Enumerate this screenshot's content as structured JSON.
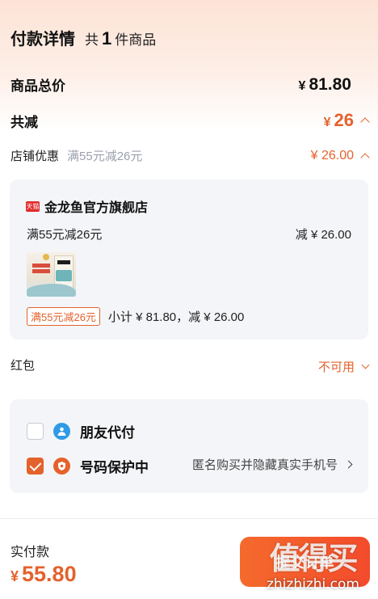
{
  "header": {
    "title": "付款详情",
    "count_prefix": "共",
    "count": "1",
    "count_suffix": "件商品"
  },
  "totals": {
    "goods_total_label": "商品总价",
    "currency": "¥",
    "goods_total_value": "81.80",
    "discount_label": "共减",
    "discount_value": "26"
  },
  "shop_discount": {
    "label": "店铺优惠",
    "description": "满55元减26元",
    "value": "¥ 26.00"
  },
  "shop_card": {
    "badge": "天猫",
    "shop_name": "金龙鱼官方旗舰店",
    "promo_text": "满55元减26元",
    "promo_reduce": "减 ¥ 26.00",
    "promo_tag": "满55元减26元",
    "subtotal_text": "小计 ¥ 81.80，减 ¥ 26.00"
  },
  "red_packet": {
    "label": "红包",
    "status": "不可用"
  },
  "options": {
    "friend_pay_label": "朋友代付",
    "friend_pay_checked": false,
    "privacy_label": "号码保护中",
    "privacy_checked": true,
    "privacy_hint": "匿名购买并隐藏真实手机号"
  },
  "footer": {
    "pay_label": "实付款",
    "currency": "¥",
    "pay_amount": "55.80",
    "submit_label": "提交订单",
    "watermark_main": "值得买",
    "watermark_sub": "zhizhizhi.com"
  },
  "colors": {
    "accent": "#e4622c",
    "card_bg": "#f4f5f8",
    "header_gradient": "#fde3d6"
  }
}
